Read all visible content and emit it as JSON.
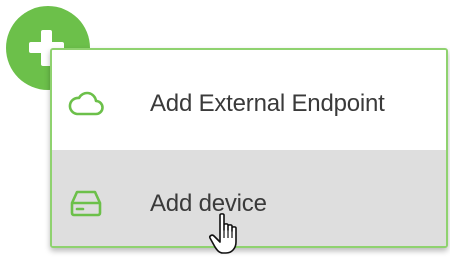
{
  "fab": {
    "icon": "plus-icon",
    "color": "#6cc04a"
  },
  "menu": {
    "border_color": "#8fd26f",
    "items": [
      {
        "label": "Add External Endpoint",
        "icon": "cloud-icon",
        "highlighted": false
      },
      {
        "label": "Add device",
        "icon": "device-drive-icon",
        "highlighted": true
      }
    ]
  },
  "cursor": {
    "icon": "hand-pointer-icon"
  }
}
